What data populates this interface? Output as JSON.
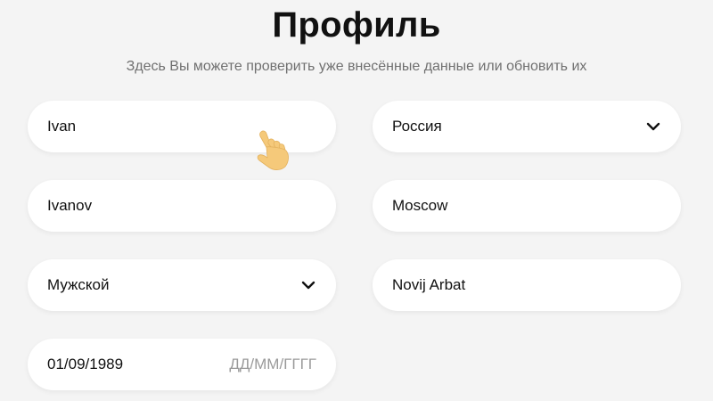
{
  "header": {
    "title": "Профиль",
    "subtitle": "Здесь Вы можете проверить уже внесённые данные или обновить их"
  },
  "form": {
    "first_name": {
      "value": "Ivan"
    },
    "last_name": {
      "value": "Ivanov"
    },
    "gender": {
      "value": "Мужской",
      "icon": "chevron-down-icon"
    },
    "birth_date": {
      "value": "01/09/1989",
      "format_hint": "ДД/ММ/ГГГГ"
    },
    "country": {
      "value": "Россия",
      "icon": "chevron-down-icon"
    },
    "city": {
      "value": "Moscow"
    },
    "street": {
      "value": "Novij Arbat"
    }
  },
  "cursor": {
    "icon": "pointer-hand-icon",
    "color": "#f5c97a"
  },
  "colors": {
    "background": "#f4f4f4",
    "field_bg": "#ffffff",
    "text": "#111111",
    "muted": "#707070"
  }
}
